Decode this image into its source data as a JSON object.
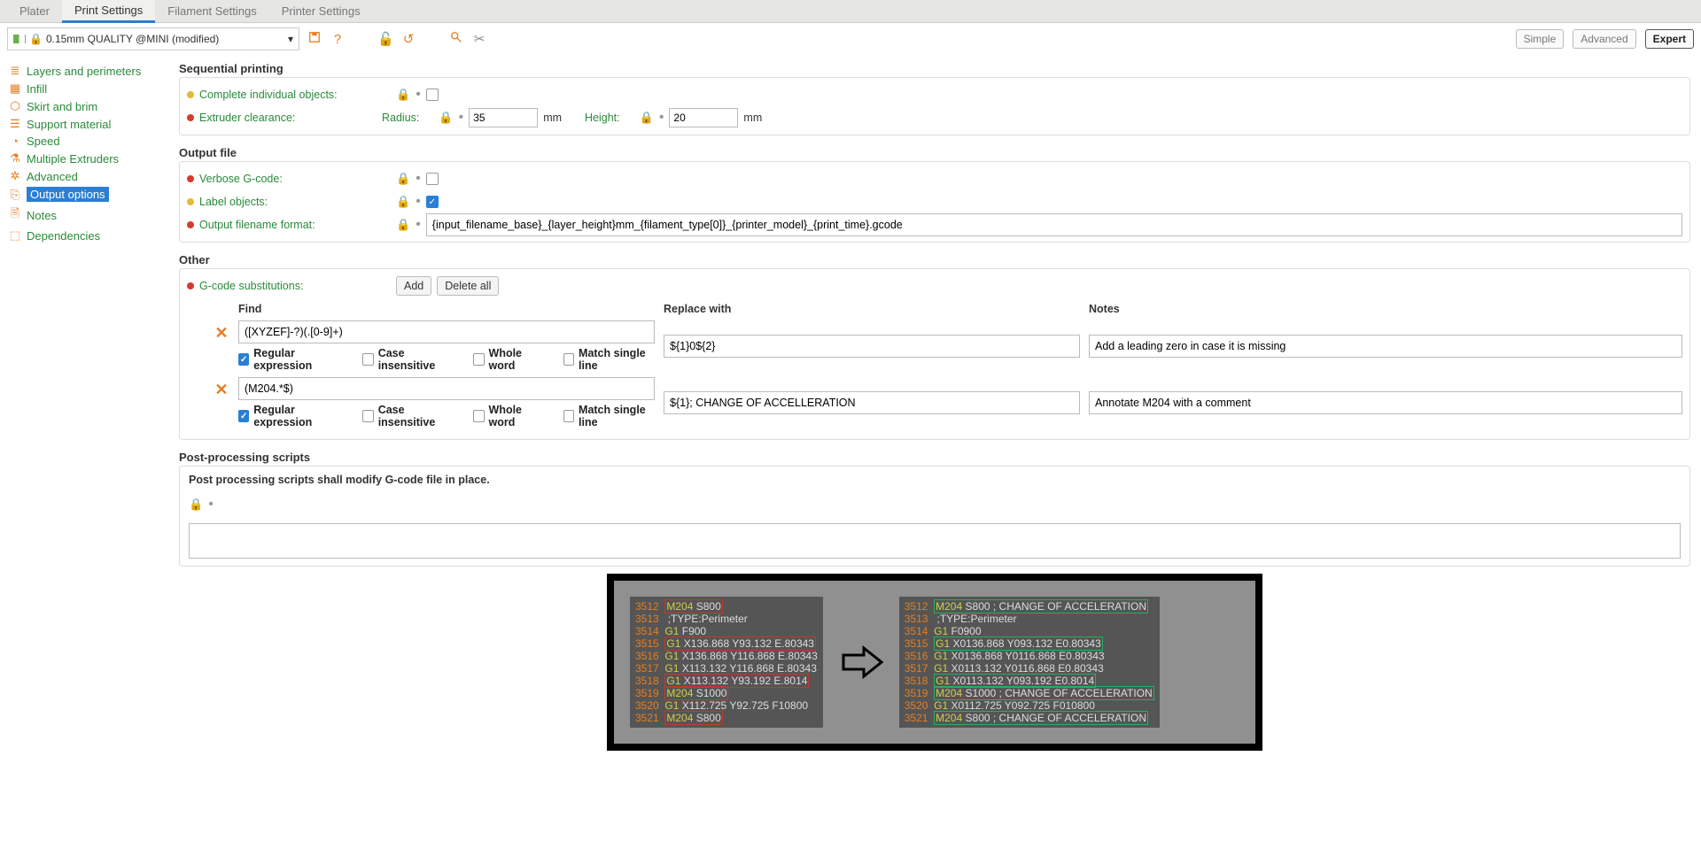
{
  "tabs": {
    "plater": "Plater",
    "print": "Print Settings",
    "filament": "Filament Settings",
    "printer": "Printer Settings"
  },
  "preset": "0.15mm QUALITY @MINI (modified)",
  "modes": {
    "simple": "Simple",
    "advanced": "Advanced",
    "expert": "Expert"
  },
  "sidebar": {
    "layers": "Layers and perimeters",
    "infill": "Infill",
    "skirt": "Skirt and brim",
    "support": "Support material",
    "speed": "Speed",
    "multi": "Multiple Extruders",
    "advanced": "Advanced",
    "output": "Output options",
    "notes": "Notes",
    "deps": "Dependencies"
  },
  "sections": {
    "sequential": {
      "title": "Sequential printing",
      "complete": "Complete individual objects:",
      "clearance": "Extruder clearance:",
      "radius": "Radius:",
      "radius_val": "35",
      "height": "Height:",
      "height_val": "20",
      "mm": "mm"
    },
    "output": {
      "title": "Output file",
      "verbose": "Verbose G-code:",
      "label_obj": "Label objects:",
      "fname": "Output filename format:",
      "fname_val": "{input_filename_base}_{layer_height}mm_{filament_type[0]}_{printer_model}_{print_time}.gcode"
    },
    "other": {
      "title": "Other",
      "subs": "G-code substitutions:",
      "add": "Add",
      "del": "Delete all",
      "find": "Find",
      "replace": "Replace with",
      "notes": "Notes"
    },
    "post": {
      "title": "Post-processing scripts",
      "desc": "Post processing scripts shall modify G-code file in place."
    }
  },
  "subs": [
    {
      "find": "([XYZEF]-?)(.[0-9]+)",
      "replace": "${1}0${2}",
      "notes": "Add a leading zero in case it is missing",
      "regex": true,
      "icase": false,
      "whole": false,
      "single": false
    },
    {
      "find": "(M204.*$)",
      "replace": "${1}; CHANGE OF ACCELLERATION",
      "notes": "Annotate M204 with a comment",
      "regex": true,
      "icase": false,
      "whole": false,
      "single": false
    }
  ],
  "opt_labels": {
    "regex": "Regular expression",
    "icase": "Case insensitive",
    "whole": "Whole word",
    "single": "Match single line"
  },
  "gcode": {
    "before": [
      {
        "n": "3512",
        "cmd": "M204",
        "args": "S800",
        "box": "red"
      },
      {
        "n": "3513",
        "cmd": "",
        "args": ";TYPE:Perimeter"
      },
      {
        "n": "3514",
        "cmd": "G1",
        "args": "F900"
      },
      {
        "n": "3515",
        "cmd": "G1",
        "args": "X136.868 Y93.132 E.80343",
        "box": "red"
      },
      {
        "n": "3516",
        "cmd": "G1",
        "args": "X136.868 Y116.868 E.80343"
      },
      {
        "n": "3517",
        "cmd": "G1",
        "args": "X113.132 Y116.868 E.80343"
      },
      {
        "n": "3518",
        "cmd": "G1",
        "args": "X113.132 Y93.192 E.8014",
        "box": "red"
      },
      {
        "n": "3519",
        "cmd": "M204",
        "args": "S1000",
        "box": "red"
      },
      {
        "n": "3520",
        "cmd": "G1",
        "args": "X112.725 Y92.725 F10800"
      },
      {
        "n": "3521",
        "cmd": "M204",
        "args": "S800",
        "box": "red"
      }
    ],
    "after": [
      {
        "n": "3512",
        "cmd": "M204",
        "args": "S800 ; CHANGE OF ACCELERATION",
        "box": "green"
      },
      {
        "n": "3513",
        "cmd": "",
        "args": ";TYPE:Perimeter"
      },
      {
        "n": "3514",
        "cmd": "G1",
        "args": "F0900"
      },
      {
        "n": "3515",
        "cmd": "G1",
        "args": "X0136.868 Y093.132 E0.80343",
        "box": "green"
      },
      {
        "n": "3516",
        "cmd": "G1",
        "args": "X0136.868 Y0116.868 E0.80343"
      },
      {
        "n": "3517",
        "cmd": "G1",
        "args": "X0113.132 Y0116.868 E0.80343"
      },
      {
        "n": "3518",
        "cmd": "G1",
        "args": "X0113.132 Y093.192 E0.8014",
        "box": "green"
      },
      {
        "n": "3519",
        "cmd": "M204",
        "args": "S1000 ; CHANGE OF ACCELERATION",
        "box": "green"
      },
      {
        "n": "3520",
        "cmd": "G1",
        "args": "X0112.725 Y092.725 F010800"
      },
      {
        "n": "3521",
        "cmd": "M204",
        "args": "S800 ; CHANGE OF ACCELERATION",
        "box": "green"
      }
    ]
  }
}
